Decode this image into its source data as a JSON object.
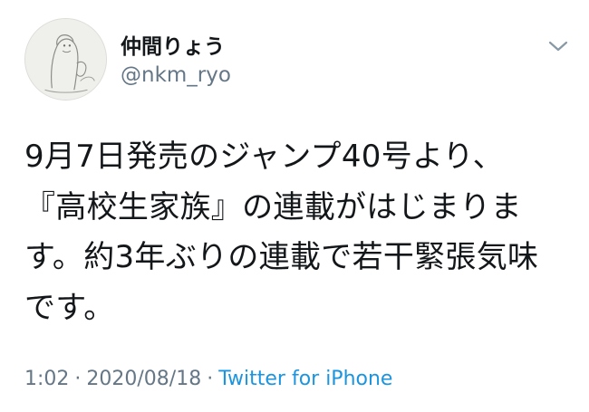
{
  "user": {
    "display_name": "仲間りょう",
    "handle": "@nkm_ryo",
    "avatar_icon": "avatar-illustration"
  },
  "menu": {
    "icon": "chevron-down-icon"
  },
  "tweet": {
    "lines": [
      "9月7日発売のジャンプ40号より、",
      "『高校生家族』の連載がはじまりま",
      "す。約3年ぶりの連載で若干緊張気味",
      "です。"
    ]
  },
  "meta": {
    "time": "1:02",
    "separator": "·",
    "date": "2020/08/18",
    "source": "Twitter for iPhone"
  },
  "colors": {
    "text": "#14171a",
    "secondary": "#657786",
    "link": "#1b95e0"
  }
}
